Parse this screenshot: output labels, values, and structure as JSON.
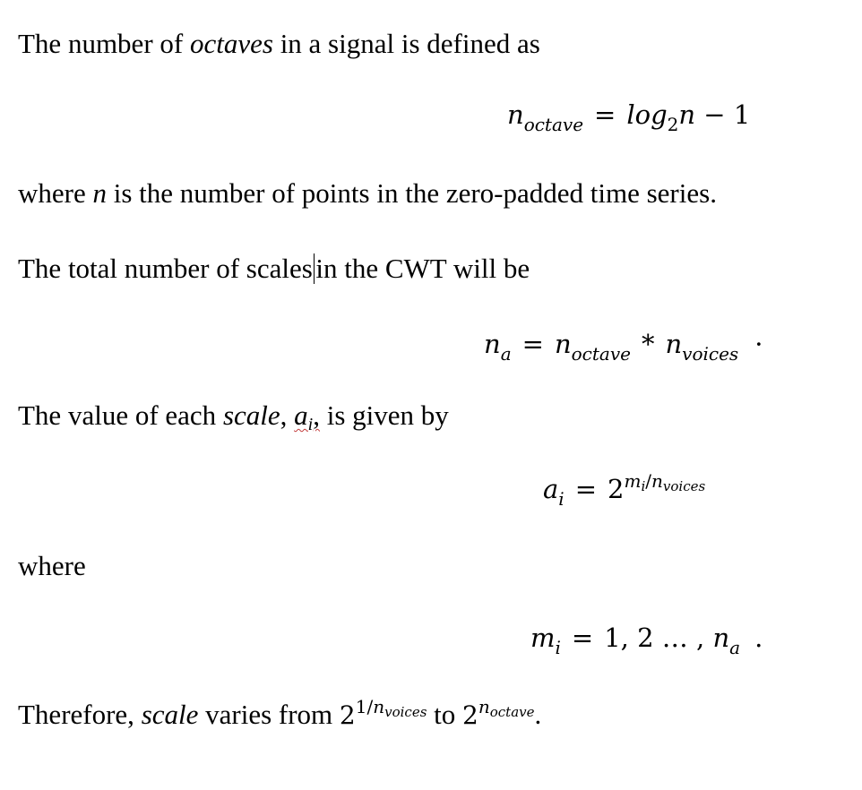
{
  "p1": {
    "before": "The number of ",
    "italic": "octaves",
    "after": " in a signal is defined as"
  },
  "eq1": {
    "n": "n",
    "sub": "octave",
    "eq": "=",
    "rhs_a": "log",
    "rhs_sub": "2",
    "rhs_b": "n",
    "rhs_c": " − 1"
  },
  "p2": {
    "before": "where ",
    "italic": "n",
    "after": " is the number of points in the zero-padded time series."
  },
  "p3": {
    "before": "The total number of scales",
    "after": "in the CWT will be"
  },
  "eq2": {
    "n1": "n",
    "sub1": "a",
    "eq": "=",
    "n2": "n",
    "sub2": "octave",
    "mult": "*",
    "n3": "n",
    "sub3": "voices",
    "dot": "·"
  },
  "p4": {
    "before": "The value of each ",
    "italic": "scale",
    "comma": ", ",
    "ai": "a",
    "ai_sub": "i",
    "after_sq": ",",
    "after": " is given by"
  },
  "eq3": {
    "a": "a",
    "sub": "i",
    "eq": "=",
    "base": "2",
    "exp_m": "m",
    "exp_msub": "i",
    "exp_slash": "/",
    "exp_n": "n",
    "exp_nsub": "voices"
  },
  "p5": {
    "text": "where"
  },
  "eq4": {
    "m": "m",
    "sub": "i",
    "eq": "=",
    "seq": "1, 2 … ,",
    "n": "n",
    "nsub": "a",
    "dot": "."
  },
  "p6": {
    "before": "Therefore, ",
    "italic": "scale",
    "mid": " varies from ",
    "base1": "2",
    "exp1": "1/",
    "exp1n": "n",
    "exp1sub": "voices",
    "to": " to ",
    "base2": "2",
    "exp2n": "n",
    "exp2sub": "octave",
    "end": "."
  }
}
